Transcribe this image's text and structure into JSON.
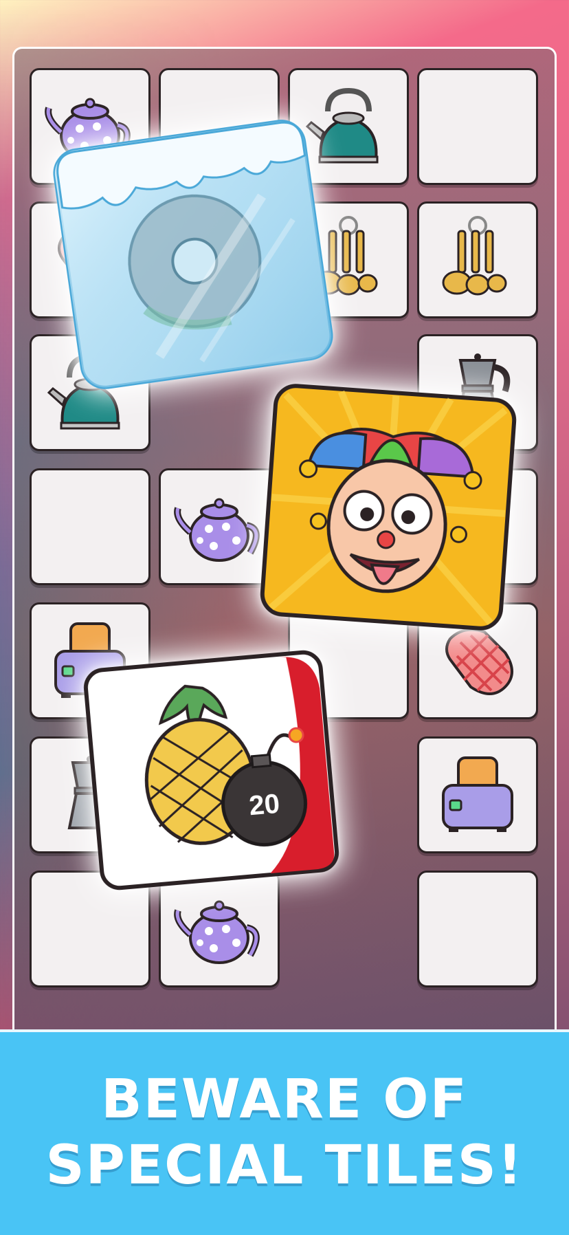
{
  "banner": {
    "line1": "BEWARE OF",
    "line2": "SPECIAL TILES!"
  },
  "special_tiles": {
    "ice": {
      "icon": "frozen-donut-icon"
    },
    "jester": {
      "icon": "jester-face-icon"
    },
    "bomb": {
      "icon": "pineapple-icon",
      "bomb_counter": "20",
      "bomb_icon": "bomb-icon"
    }
  },
  "board": {
    "tiles": [
      {
        "row": 0,
        "col": 0,
        "icon": "teapot-icon"
      },
      {
        "row": 0,
        "col": 1,
        "icon": "blank"
      },
      {
        "row": 0,
        "col": 2,
        "icon": "kettle-icon"
      },
      {
        "row": 0,
        "col": 3,
        "icon": "blank"
      },
      {
        "row": 1,
        "col": 0,
        "icon": "oven-mitt-icon"
      },
      {
        "row": 1,
        "col": 2,
        "icon": "measuring-spoons-icon"
      },
      {
        "row": 1,
        "col": 3,
        "icon": "measuring-spoons-icon"
      },
      {
        "row": 2,
        "col": 0,
        "icon": "kettle-icon"
      },
      {
        "row": 2,
        "col": 3,
        "icon": "moka-pot-icon"
      },
      {
        "row": 3,
        "col": 0,
        "icon": "blank"
      },
      {
        "row": 3,
        "col": 1,
        "icon": "teapot-icon"
      },
      {
        "row": 3,
        "col": 3,
        "icon": "blank"
      },
      {
        "row": 4,
        "col": 0,
        "icon": "toaster-icon"
      },
      {
        "row": 4,
        "col": 2,
        "icon": "blank"
      },
      {
        "row": 4,
        "col": 3,
        "icon": "oven-mitt-icon"
      },
      {
        "row": 5,
        "col": 0,
        "icon": "moka-pot-icon"
      },
      {
        "row": 5,
        "col": 3,
        "icon": "toaster-icon"
      },
      {
        "row": 6,
        "col": 0,
        "icon": "blank"
      },
      {
        "row": 6,
        "col": 1,
        "icon": "teapot-icon"
      },
      {
        "row": 6,
        "col": 3,
        "icon": "blank"
      }
    ]
  },
  "colors": {
    "banner_bg": "#49c4f5",
    "tile_bg": "#f3f0f1",
    "jester_bg": "#f6b81f",
    "bomb_stripe": "#d81e2c"
  }
}
